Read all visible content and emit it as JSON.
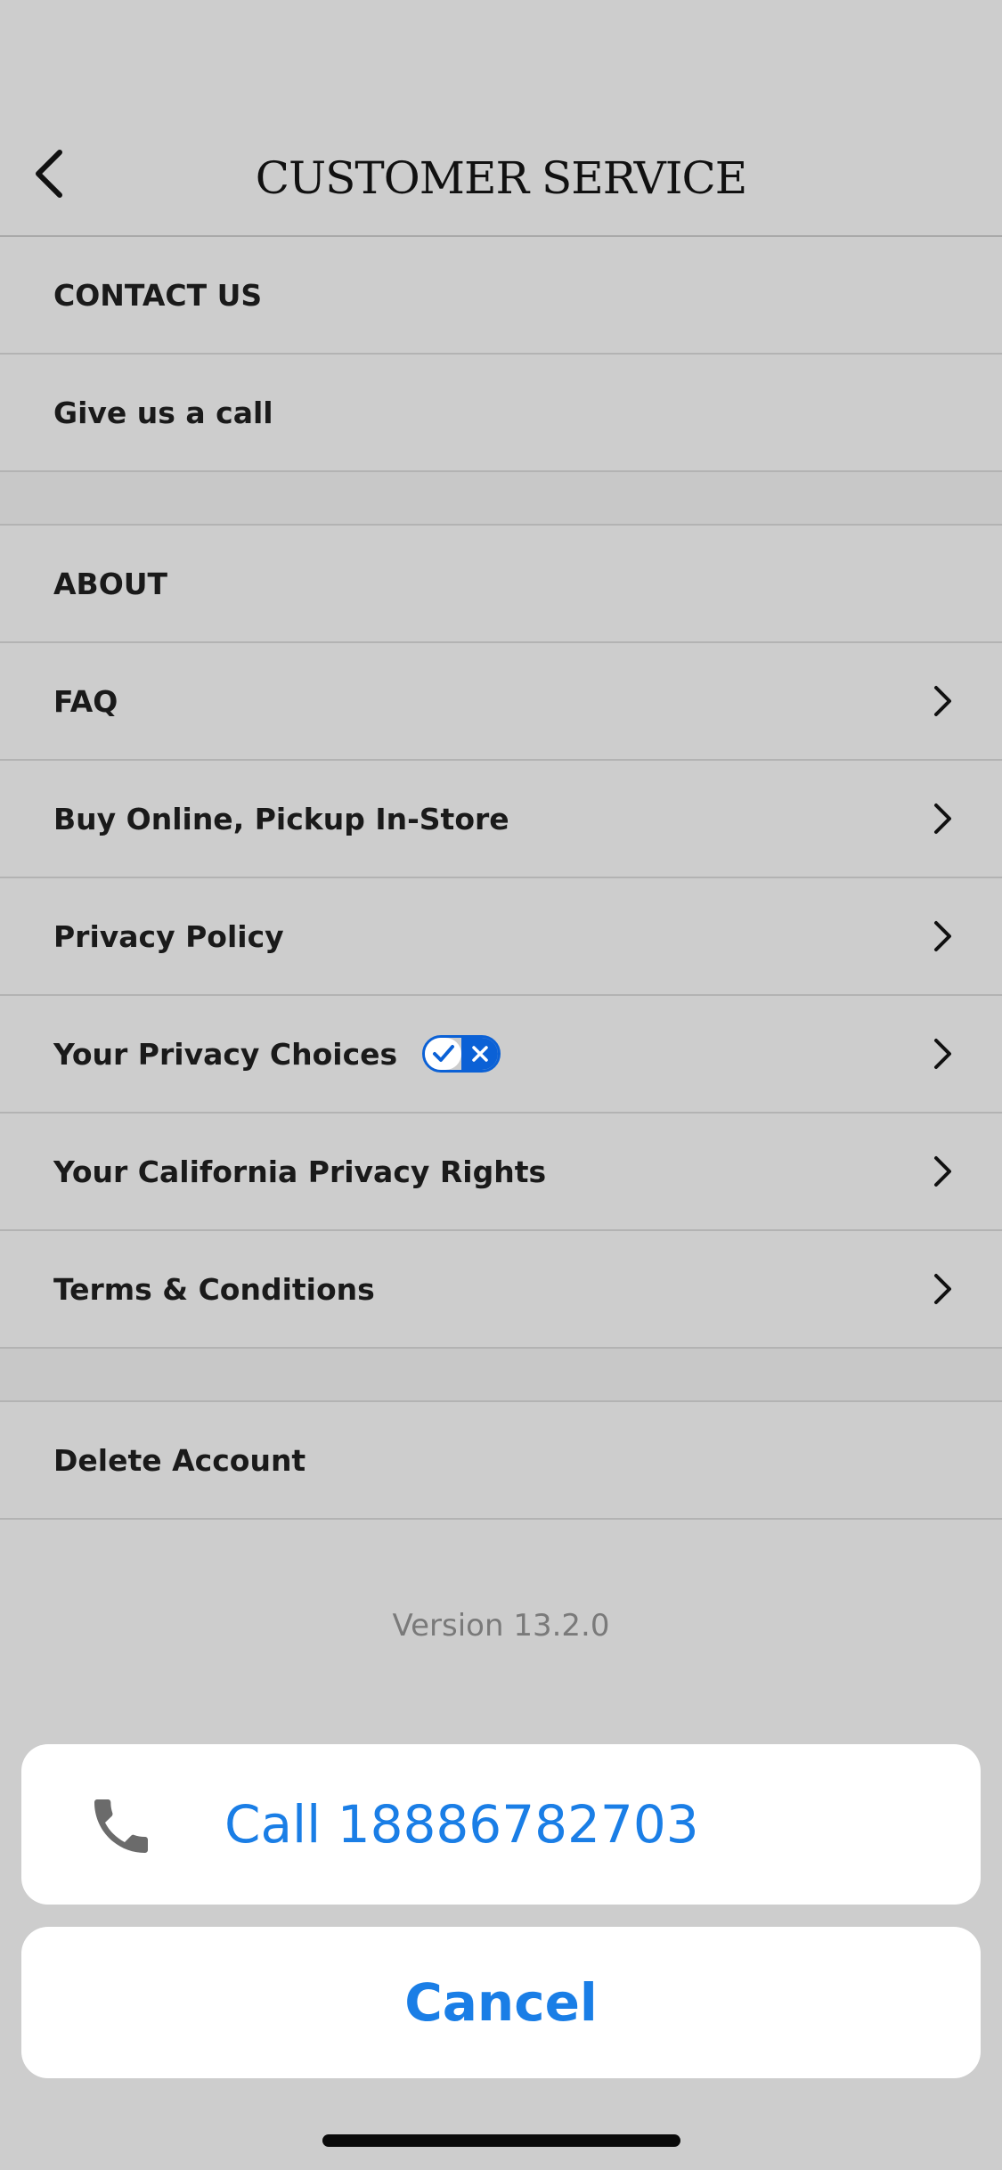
{
  "header": {
    "title": "CUSTOMER SERVICE"
  },
  "contact": {
    "section_label": "CONTACT US",
    "call_label": "Give us a call"
  },
  "about": {
    "section_label": "ABOUT",
    "items": [
      {
        "label": "FAQ"
      },
      {
        "label": "Buy Online, Pickup In-Store"
      },
      {
        "label": "Privacy Policy"
      },
      {
        "label": "Your Privacy Choices"
      },
      {
        "label": "Your California Privacy Rights"
      },
      {
        "label": "Terms & Conditions"
      }
    ]
  },
  "account": {
    "delete_label": "Delete Account"
  },
  "version": "Version 13.2.0",
  "action_sheet": {
    "call_label": "Call 18886782703",
    "cancel_label": "Cancel"
  },
  "colors": {
    "background": "#cdcdcd",
    "accent_blue": "#1a7ee6",
    "privacy_blue": "#0b61d6"
  }
}
